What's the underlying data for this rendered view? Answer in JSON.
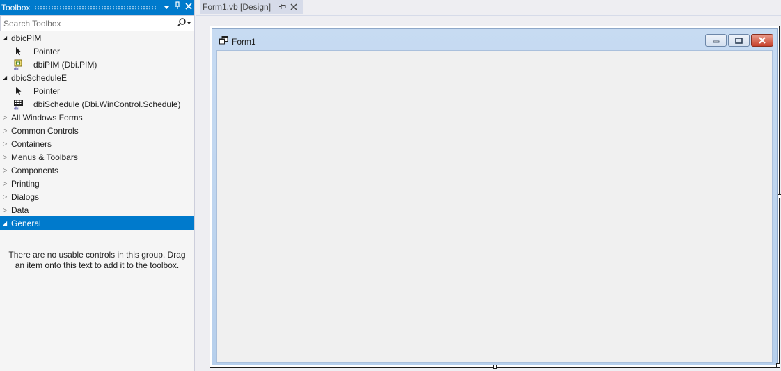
{
  "toolbox": {
    "title": "Toolbox",
    "search_placeholder": "Search Toolbox",
    "groups": [
      {
        "label": "dbicPIM",
        "expanded": true,
        "items": [
          {
            "label": "Pointer",
            "icon": "pointer-icon"
          },
          {
            "label": "dbiPIM (Dbi.PIM)",
            "icon": "dbipim-icon"
          }
        ]
      },
      {
        "label": "dbicScheduleE",
        "expanded": true,
        "items": [
          {
            "label": "Pointer",
            "icon": "pointer-icon"
          },
          {
            "label": "dbiSchedule (Dbi.WinControl.Schedule)",
            "icon": "dbischedule-icon"
          }
        ]
      },
      {
        "label": "All Windows Forms",
        "expanded": false
      },
      {
        "label": "Common Controls",
        "expanded": false
      },
      {
        "label": "Containers",
        "expanded": false
      },
      {
        "label": "Menus & Toolbars",
        "expanded": false
      },
      {
        "label": "Components",
        "expanded": false
      },
      {
        "label": "Printing",
        "expanded": false
      },
      {
        "label": "Dialogs",
        "expanded": false
      },
      {
        "label": "Data",
        "expanded": false
      },
      {
        "label": "General",
        "expanded": true,
        "selected": true
      }
    ],
    "empty_message": "There are no usable controls in this group. Drag an item onto this text to add it to the toolbox."
  },
  "document": {
    "tab_label": "Form1.vb [Design]",
    "form_title": "Form1"
  },
  "colors": {
    "accent": "#007acc",
    "form_caption": "#c7dbf2",
    "form_client": "#f0f0f0",
    "close_button": "#c7402a"
  }
}
